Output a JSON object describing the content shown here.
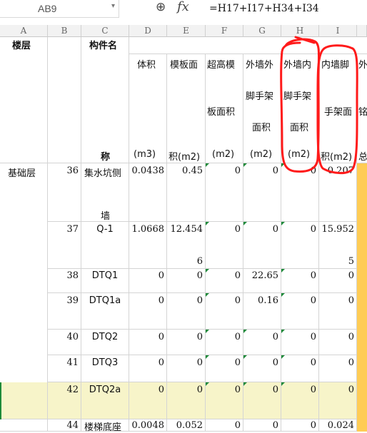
{
  "formula_bar": {
    "name_box": "AB9",
    "fx_label": "fx",
    "formula": "=H17+I17+H34+I34"
  },
  "column_headers": [
    "A",
    "B",
    "C",
    "D",
    "E",
    "F",
    "G",
    "H",
    "I"
  ],
  "headers": {
    "a": "楼层",
    "c_top": "构件名",
    "c_bottom": "称",
    "d_line1": "体积",
    "d_unit": "(m3)",
    "e_line1": "模板面",
    "e_unit": "积(m2)",
    "f_line1": "超高模",
    "f_line2": "板面积",
    "f_unit": "(m2)",
    "g_line1": "外墙外",
    "g_line2": "脚手架",
    "g_line3": "面积",
    "g_unit": "(m2)",
    "h_line1": "外墙内",
    "h_line2": "脚手架",
    "h_line3": "面积",
    "h_unit": "(m2)",
    "i_line1": "内墙脚",
    "i_line2": "手架面",
    "i_unit": "积(m2)",
    "j_line1": "外",
    "j_line2": "铭",
    "j_unit": "总"
  },
  "rows": [
    {
      "floor": "基础层",
      "b": "36",
      "c": "集水坑侧",
      "c2": "墙",
      "d": "0.0438",
      "e": "0.45",
      "f": "0",
      "g": "0",
      "h": "0",
      "i": "0.207",
      "i2": ""
    },
    {
      "floor": "",
      "b": "37",
      "c": "Q-1",
      "c2": "",
      "d": "1.0668",
      "e": "12.454",
      "e2": "6",
      "f": "0",
      "g": "0",
      "h": "0",
      "i": "15.952",
      "i2": "5"
    },
    {
      "floor": "",
      "b": "38",
      "c": "DTQ1",
      "c2": "",
      "d": "0",
      "e": "0",
      "f": "0",
      "g": "22.65",
      "h": "0",
      "i": "0"
    },
    {
      "floor": "",
      "b": "39",
      "c": "DTQ1a",
      "c2": "",
      "d": "0",
      "e": "0",
      "f": "0",
      "g": "0.16",
      "h": "0",
      "i": "0"
    },
    {
      "floor": "",
      "b": "40",
      "c": "DTQ2",
      "c2": "",
      "d": "0",
      "e": "0",
      "f": "0",
      "g": "0",
      "h": "0",
      "i": "0"
    },
    {
      "floor": "",
      "b": "41",
      "c": "DTQ3",
      "c2": "",
      "d": "0",
      "e": "0",
      "f": "0",
      "g": "0",
      "h": "0",
      "i": "0"
    },
    {
      "floor": "",
      "b": "42",
      "c": "DTQ2a",
      "c2": "",
      "d": "0",
      "e": "0",
      "f": "0",
      "g": "0",
      "h": "0",
      "i": "0"
    },
    {
      "floor": "",
      "b": "44",
      "c": "楼梯底座",
      "c2": "",
      "d": "0.0048",
      "e": "0.052",
      "f": "0",
      "g": "0",
      "h": "0",
      "i": "0.024"
    }
  ],
  "colors": {
    "annotation": "#ff1a1a",
    "highlight_row": "#f7f4c9",
    "accent_column": "#ffcc55",
    "comment_marker": "#1e8a3a"
  }
}
